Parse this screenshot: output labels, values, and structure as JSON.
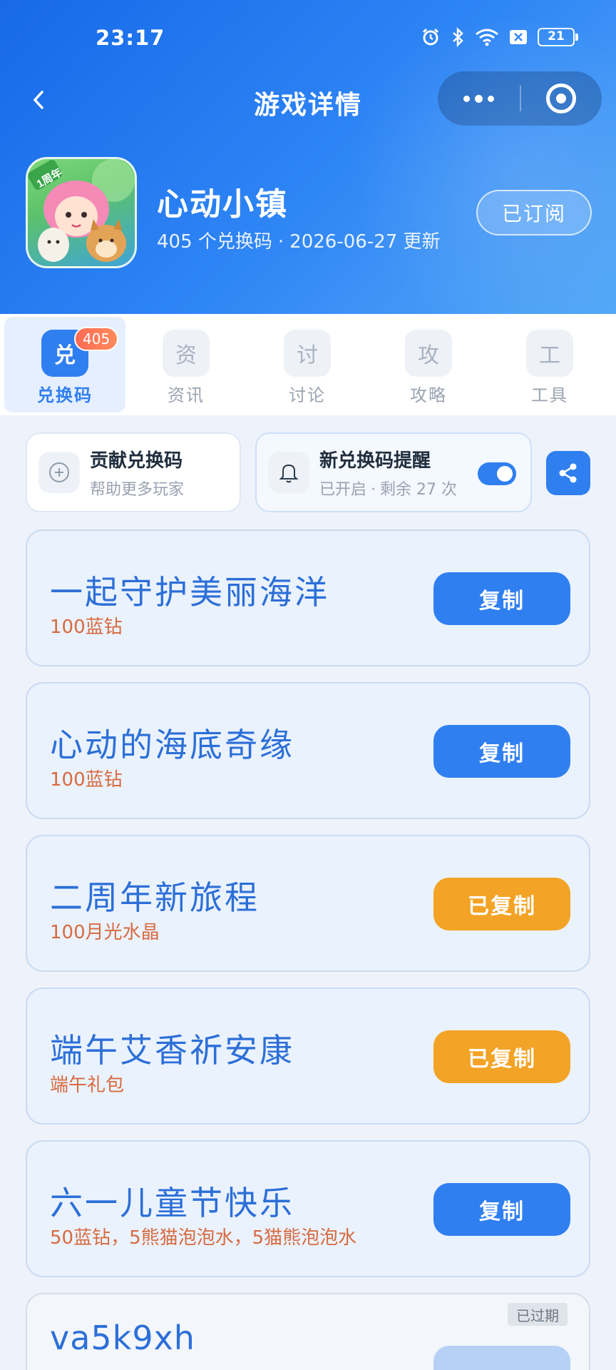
{
  "status_bar": {
    "time": "23:17",
    "battery": "21",
    "icons": [
      "alarm-icon",
      "bluetooth-icon",
      "wifi-icon",
      "sim-off-icon",
      "battery-icon"
    ]
  },
  "nav": {
    "title": "游戏详情",
    "back_icon": "chevron-left-icon"
  },
  "game": {
    "name": "心动小镇",
    "code_count": "405 个兑换码",
    "separator": "·",
    "updated": "2026-06-27 更新",
    "subscribe_label": "已订阅",
    "icon_badge": "1周年"
  },
  "tabs": [
    {
      "icon_char": "兑",
      "label": "兑换码",
      "badge": "405",
      "active": true
    },
    {
      "icon_char": "资",
      "label": "资讯",
      "active": false
    },
    {
      "icon_char": "讨",
      "label": "讨论",
      "active": false
    },
    {
      "icon_char": "攻",
      "label": "攻略",
      "active": false
    },
    {
      "icon_char": "工",
      "label": "工具",
      "active": false
    }
  ],
  "actions": {
    "contribute": {
      "title": "贡献兑换码",
      "subtitle": "帮助更多玩家"
    },
    "remind": {
      "title": "新兑换码提醒",
      "status": "已开启",
      "separator": "·",
      "remaining": "剩余 27 次",
      "enabled": true
    }
  },
  "codes": [
    {
      "code": "一起守护美丽海洋",
      "reward": "100蓝钻",
      "button": "复制",
      "copied": false
    },
    {
      "code": "心动的海底奇缘",
      "reward": "100蓝钻",
      "button": "复制",
      "copied": false
    },
    {
      "code": "二周年新旅程",
      "reward": "100月光水晶",
      "button": "已复制",
      "copied": true
    },
    {
      "code": "端午艾香祈安康",
      "reward": "端午礼包",
      "button": "已复制",
      "copied": true
    },
    {
      "code": "六一儿童节快乐",
      "reward": "50蓝钻，5熊猫泡泡水，5猫熊泡泡水",
      "button": "复制",
      "copied": false
    }
  ],
  "expired_code": {
    "code": "va5k9xh",
    "badge": "已过期"
  },
  "colors": {
    "primary": "#2f7ff0",
    "copied": "#f3a325",
    "reward": "#d96a40",
    "code_text": "#2c6fd8"
  }
}
